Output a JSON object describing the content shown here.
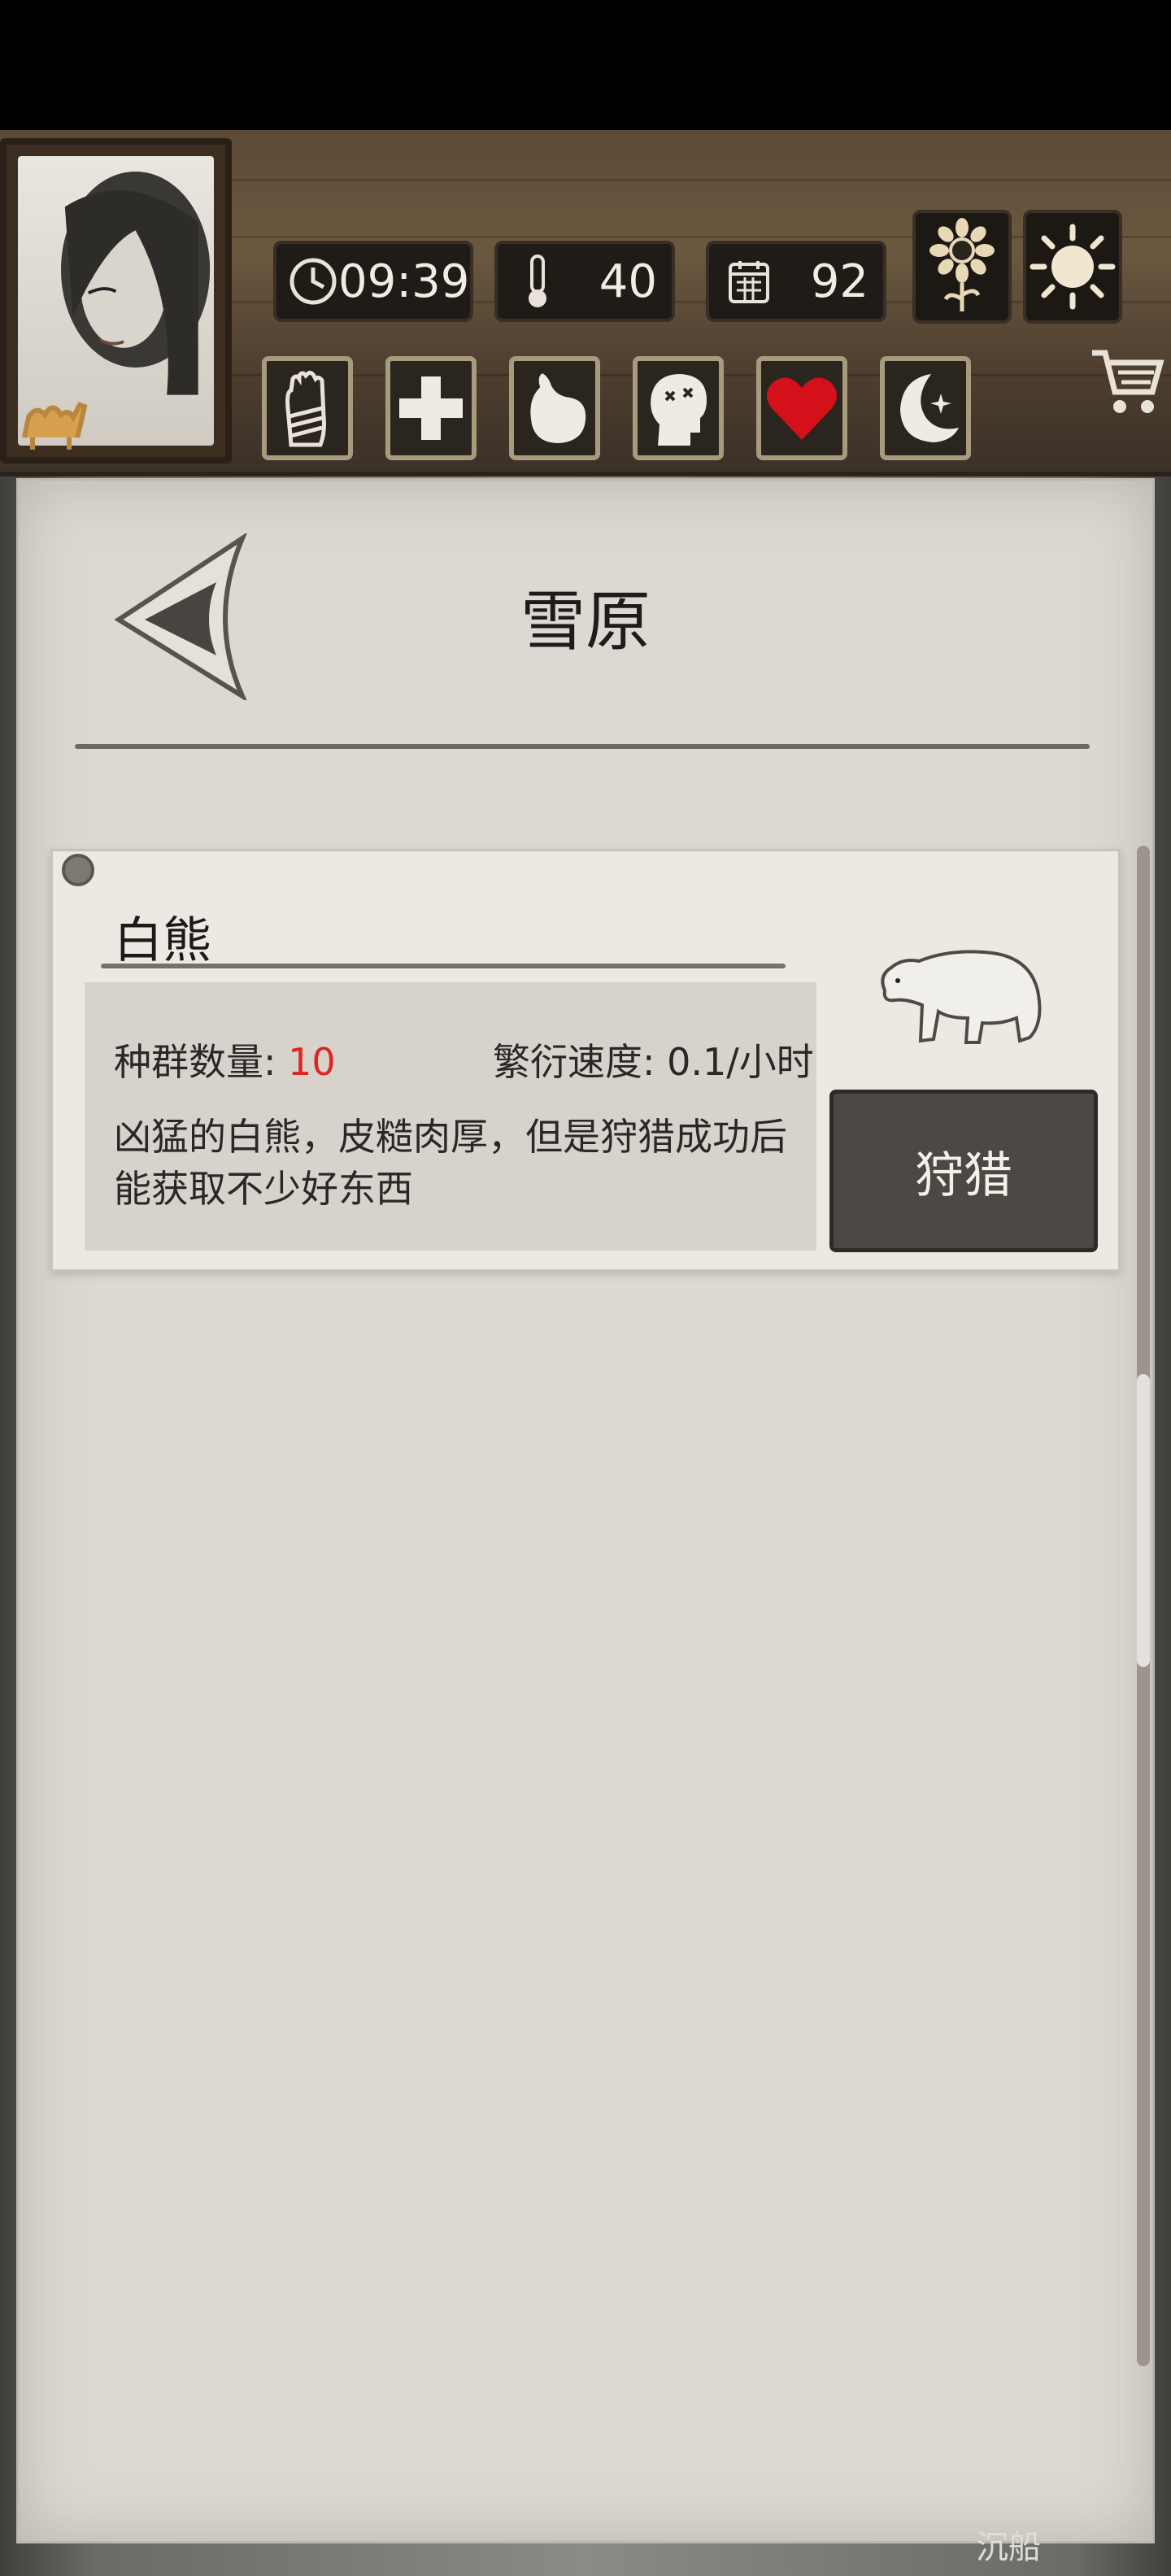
{
  "header": {
    "time": "09:39",
    "temperature": "40",
    "day": "92"
  },
  "status_icons": [
    "hand-bandage-icon",
    "health-cross-icon",
    "stomach-icon",
    "head-dizzy-icon",
    "heart-icon",
    "moon-icon"
  ],
  "page": {
    "title": "雪原"
  },
  "animal": {
    "name": "白熊",
    "population_label": "种群数量:",
    "population_value": "10",
    "breed_label": "繁衍速度:",
    "breed_value": "0.1/小时",
    "description": "凶猛的白熊，皮糙肉厚，但是狩猎成功后能获取不少好东西",
    "action": "狩猎"
  },
  "footer": {
    "partial_text": "沉船"
  },
  "colors": {
    "red_value": "#e0241f",
    "paper": "#dcd9d3",
    "button": "#4e4845",
    "wood": "#5b4a36"
  }
}
